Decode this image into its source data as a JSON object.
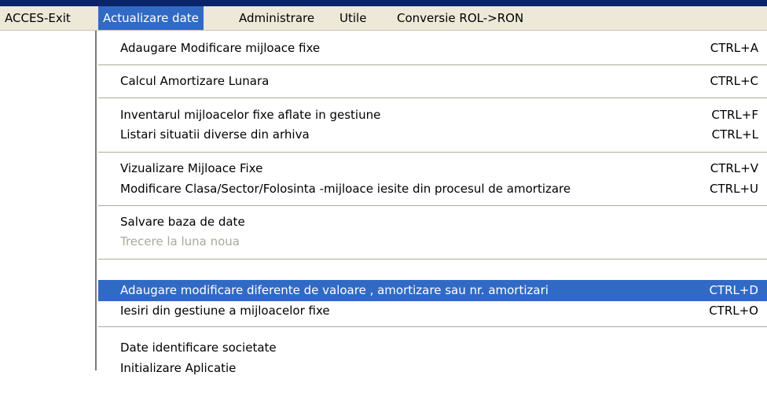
{
  "menubar": {
    "items": [
      {
        "label": "ACCES-Exit",
        "active": false
      },
      {
        "label": "Actualizare date",
        "active": true
      },
      {
        "label": "Administrare",
        "active": false
      },
      {
        "label": "Utile",
        "active": false
      },
      {
        "label": "Conversie ROL->RON",
        "active": false
      }
    ]
  },
  "dropdown": {
    "items": [
      {
        "label": "Adaugare Modificare mijloace fixe",
        "shortcut": "CTRL+A"
      },
      {
        "label": "Calcul Amortizare Lunara",
        "shortcut": "CTRL+C"
      },
      {
        "label": "Inventarul mijloacelor fixe aflate in gestiune",
        "shortcut": "CTRL+F"
      },
      {
        "label": "Listari situatii diverse din arhiva",
        "shortcut": "CTRL+L"
      },
      {
        "label": "Vizualizare Mijloace Fixe",
        "shortcut": "CTRL+V"
      },
      {
        "label": "Modificare Clasa/Sector/Folosinta -mijloace iesite din procesul de amortizare",
        "shortcut": "CTRL+U"
      },
      {
        "label": "Salvare baza de date",
        "shortcut": ""
      },
      {
        "label": "Trecere la luna noua",
        "shortcut": "",
        "disabled": true
      },
      {
        "label": "Adaugare modificare diferente de valoare , amortizare sau nr. amortizari",
        "shortcut": "CTRL+D",
        "selected": true
      },
      {
        "label": "Iesiri din gestiune a mijloacelor fixe",
        "shortcut": "CTRL+O"
      },
      {
        "label": "Date identificare societate",
        "shortcut": ""
      },
      {
        "label": "Initializare Aplicatie",
        "shortcut": ""
      }
    ]
  },
  "colors": {
    "selection": "#316ac5",
    "menubar_bg": "#ece9d8",
    "disabled_text": "#aca899"
  }
}
